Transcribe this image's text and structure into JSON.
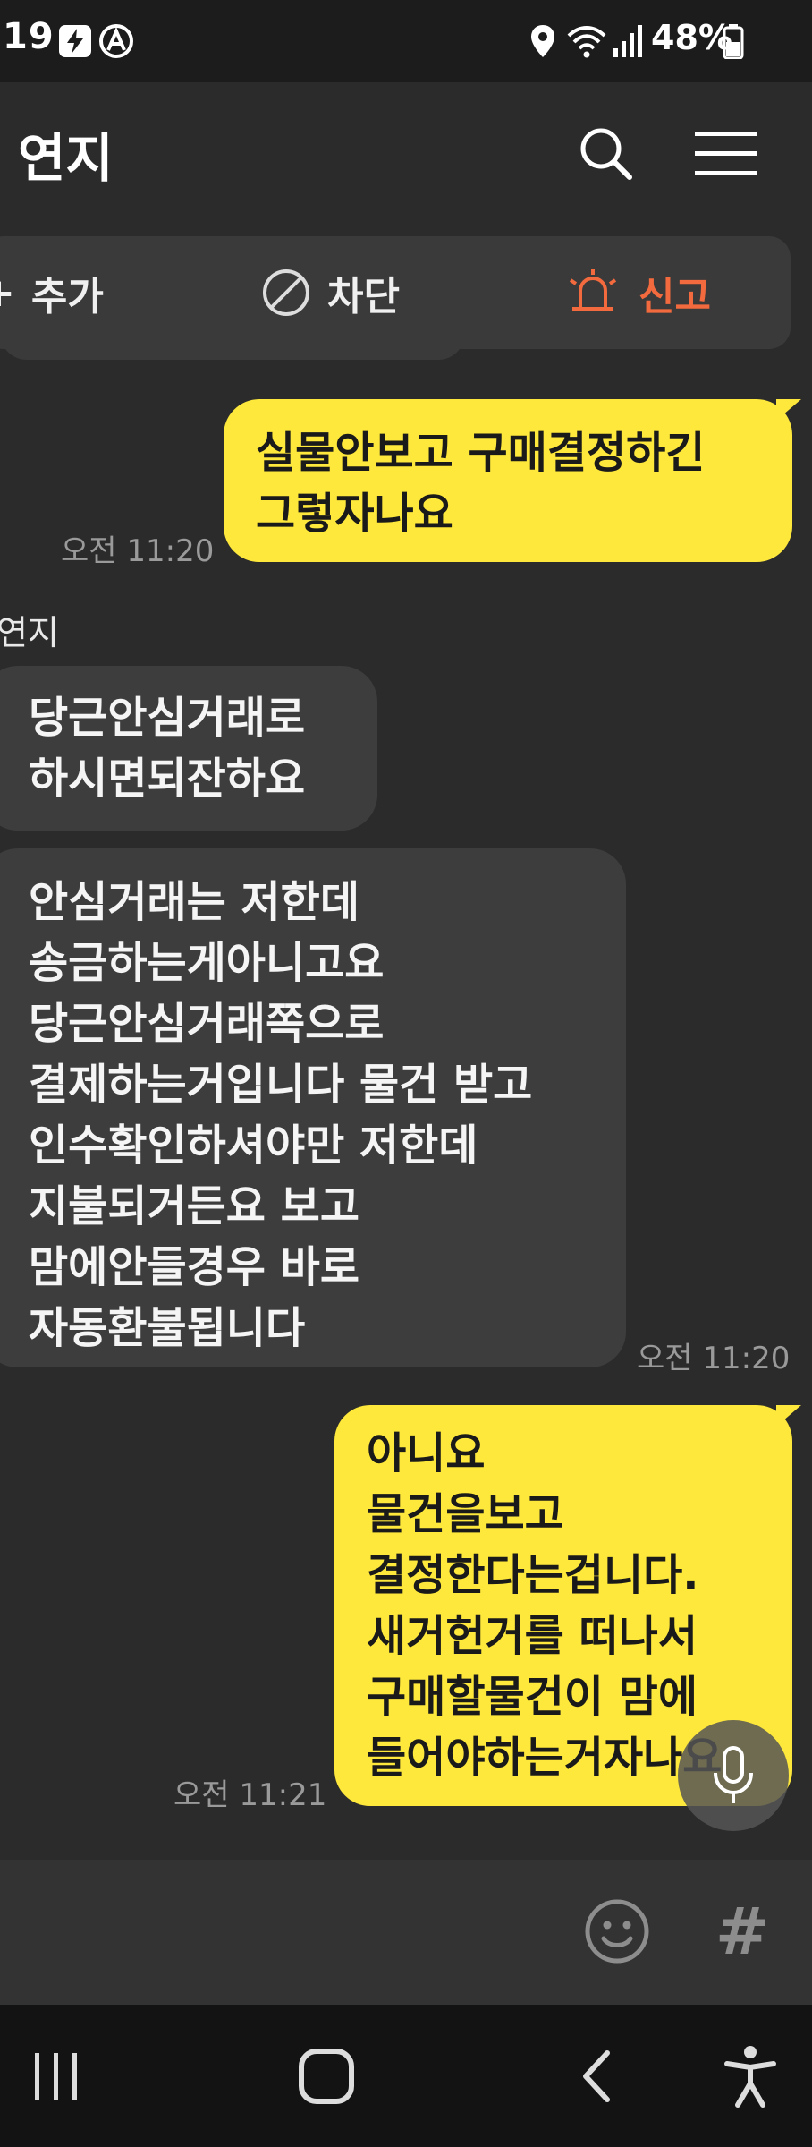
{
  "status_bar": {
    "time": ":19",
    "battery": "48%"
  },
  "header": {
    "title": "연지",
    "search_icon": "search-icon",
    "menu_icon": "hamburger-menu-icon"
  },
  "actions": {
    "add": "추가",
    "block": "차단",
    "report": "신고",
    "colors": {
      "report": "#f26a3d"
    }
  },
  "messages": [
    {
      "from": "me",
      "text": "실물안보고 구매결정하긴\n그렇자나요",
      "time": "오전 11:20"
    },
    {
      "from": "other",
      "sender": "연지",
      "text": "당근안심거래로\n하시면되잔하요"
    },
    {
      "from": "other",
      "text": "안심거래는 저한데\n송금하는게아니고요\n당근안심거래쪽으로\n결제하는거입니다  물건 받고\n인수확인하셔야만 저한데\n지불되거든요  보고\n맘에안들경우 바로\n자동환불됩니다",
      "time": "오전 11:20"
    },
    {
      "from": "me",
      "text": "아니요\n물건을보고\n결정한다는겁니다.\n새거헌거를 떠나서\n구매할물건이 맘에\n들어야하는거자나요",
      "time": "오전 11:21"
    }
  ],
  "input_bar": {
    "hash": "#"
  },
  "colors": {
    "my_bubble": "#fee83b",
    "other_bubble": "#3d3d3d",
    "background": "#2b2b2b"
  }
}
